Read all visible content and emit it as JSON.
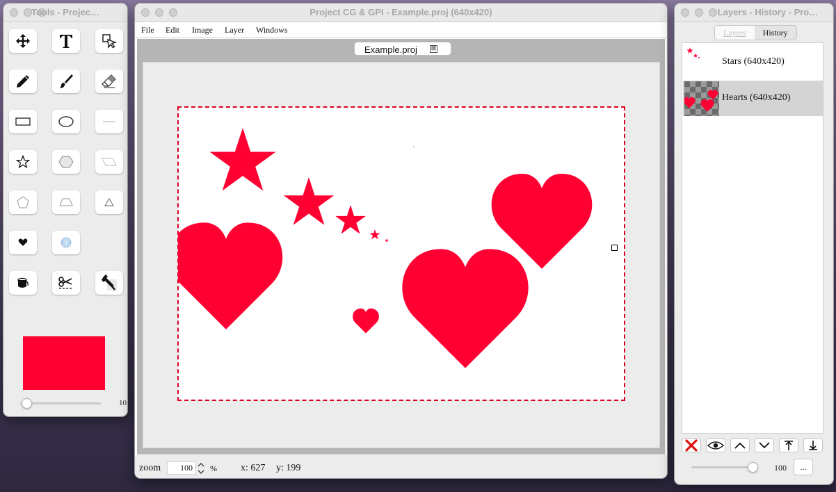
{
  "tools_window": {
    "title": "Tools - Projec…",
    "tools": [
      {
        "name": "move-tool",
        "icon": "move-arrows-icon"
      },
      {
        "name": "text-tool",
        "icon": "text-T-icon"
      },
      {
        "name": "select-tool",
        "icon": "pointer-select-icon"
      },
      {
        "name": "pencil-tool",
        "icon": "pencil-icon"
      },
      {
        "name": "brush-tool",
        "icon": "brush-icon"
      },
      {
        "name": "eraser-tool",
        "icon": "eraser-icon"
      },
      {
        "name": "rectangle-tool",
        "icon": "rectangle-icon"
      },
      {
        "name": "ellipse-tool",
        "icon": "ellipse-icon"
      },
      {
        "name": "line-tool",
        "icon": "line-icon"
      },
      {
        "name": "star-tool",
        "icon": "star-icon"
      },
      {
        "name": "hexagon-tool",
        "icon": "hexagon-icon"
      },
      {
        "name": "parallelogram-tool",
        "icon": "parallelogram-icon"
      },
      {
        "name": "pentagon-tool",
        "icon": "pentagon-icon"
      },
      {
        "name": "trapezoid-tool",
        "icon": "trapezoid-icon"
      },
      {
        "name": "triangle-tool",
        "icon": "triangle-icon"
      },
      {
        "name": "heart-tool",
        "icon": "heart-icon"
      },
      {
        "name": "gradient-tool",
        "icon": "gradient-ball-icon"
      },
      {
        "name": "bucket-tool",
        "icon": "paint-bucket-icon"
      },
      {
        "name": "cut-tool",
        "icon": "scissors-icon"
      },
      {
        "name": "eyedropper-tool",
        "icon": "eyedropper-icon"
      }
    ],
    "color": "#ff0033",
    "size_value": "10",
    "size_fraction": 0.08
  },
  "main_window": {
    "title": "Project CG & GPI - Example.proj (640x420)",
    "menu": [
      "File",
      "Edit",
      "Image",
      "Layer",
      "Windows"
    ],
    "tab_label": "Example.proj",
    "tab_close": "⊠",
    "status": {
      "zoom_label": "zoom",
      "zoom_value": "100",
      "zoom_unit": "%",
      "x_label": "x: 627",
      "y_label": "y: 199"
    }
  },
  "layers_window": {
    "title": "Layers - History - Pro…",
    "tabs": [
      "Layers",
      "History"
    ],
    "layers": [
      {
        "label": "Stars (640x420)"
      },
      {
        "label": "Hearts (640x420)"
      }
    ],
    "opacity_value": "100",
    "opacity_fraction": 0.92,
    "more_label": "..."
  },
  "colors": {
    "shape_fill": "#ff0033",
    "delete": "#e01010"
  }
}
